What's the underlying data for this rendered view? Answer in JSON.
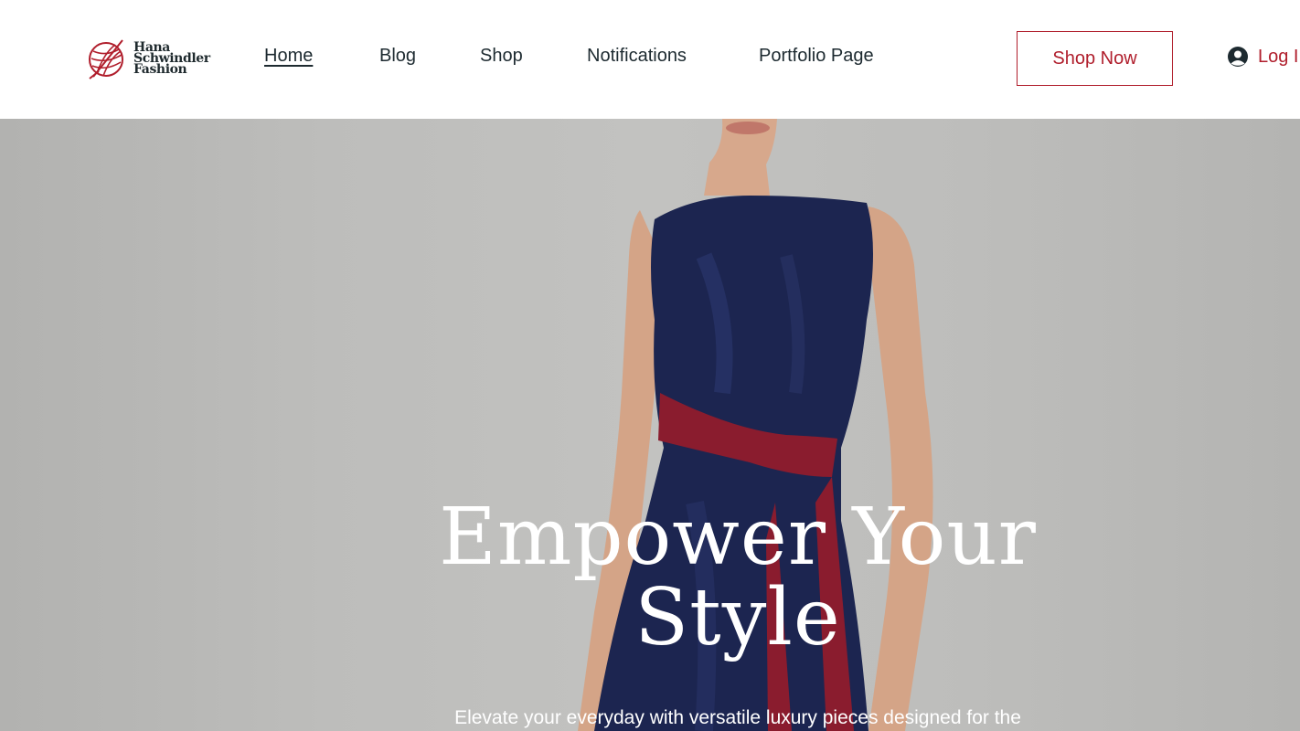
{
  "brand": {
    "name_line1": "Hana",
    "name_line2": "Schwindler",
    "name_line3": "Fashion",
    "accent_color": "#b01e2c"
  },
  "nav": {
    "items": [
      {
        "label": "Home",
        "active": true
      },
      {
        "label": "Blog"
      },
      {
        "label": "Shop"
      },
      {
        "label": "Notifications"
      },
      {
        "label": "Portfolio Page"
      }
    ]
  },
  "header": {
    "shop_now_label": "Shop Now",
    "login_label": "Log I",
    "login_icon": "user-avatar-icon"
  },
  "hero": {
    "title_line1": "Empower Your",
    "title_line2": "Style",
    "subtitle": "Elevate your everyday with versatile luxury pieces designed for the",
    "dress_color": "#1c2550",
    "sash_color": "#8a1c2e"
  }
}
